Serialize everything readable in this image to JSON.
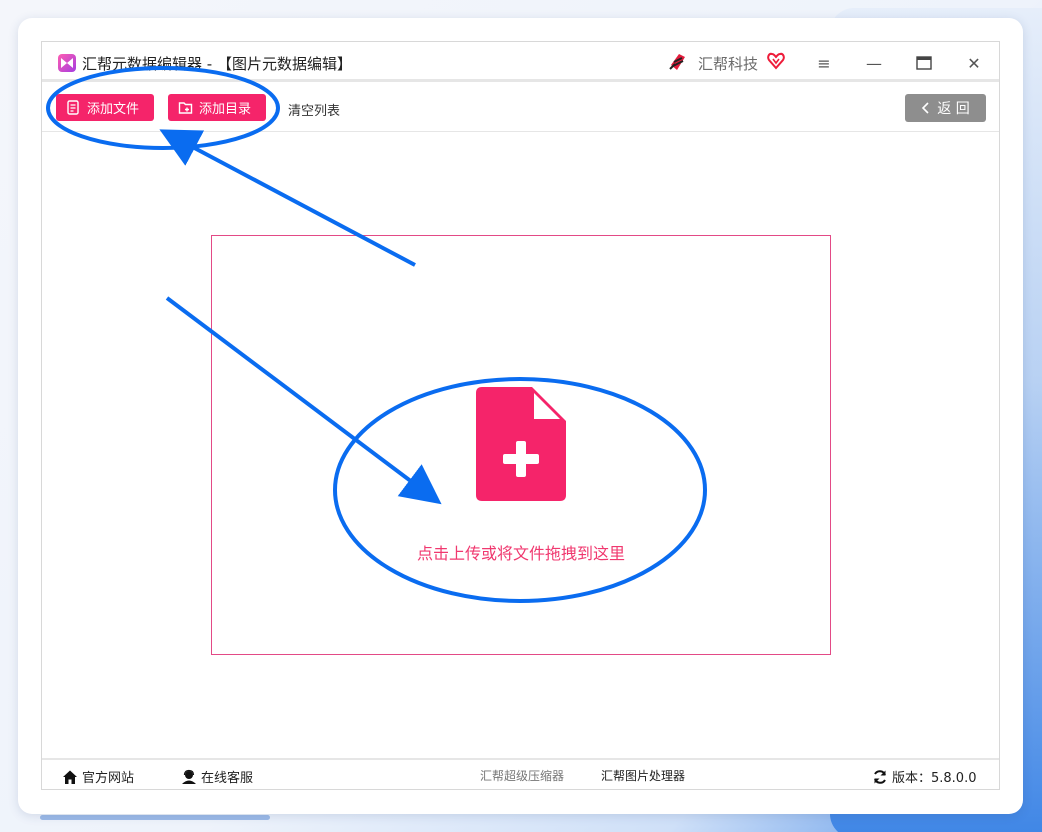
{
  "window": {
    "title": "汇帮元数据编辑器 - 【图片元数据编辑】",
    "brand_name": "汇帮科技",
    "controls": {
      "menu": "≡",
      "minimize": "—",
      "maximize": "▭",
      "close": "✕"
    }
  },
  "toolbar": {
    "add_file_label": "添加文件",
    "add_dir_label": "添加目录",
    "clear_list_label": "清空列表",
    "back_label": "返 回"
  },
  "dropzone": {
    "text": "点击上传或将文件拖拽到这里"
  },
  "statusbar": {
    "website_label": "官方网站",
    "support_label": "在线客服",
    "compressor_label": "汇帮超级压缩器",
    "image_processor_label": "汇帮图片处理器",
    "version_label": "版本：5.8.0.0"
  },
  "colors": {
    "accent": "#f5246a",
    "annotation": "#0a6cf0",
    "back_button": "#8e8e8e"
  },
  "icons": [
    "app-logo-icon",
    "brand-logo-icon",
    "vip-heart-icon",
    "menu-icon",
    "minimize-icon",
    "maximize-icon",
    "close-icon",
    "file-list-icon",
    "folder-add-icon",
    "chevron-left-icon",
    "file-add-icon",
    "home-icon",
    "support-user-icon",
    "refresh-icon"
  ]
}
